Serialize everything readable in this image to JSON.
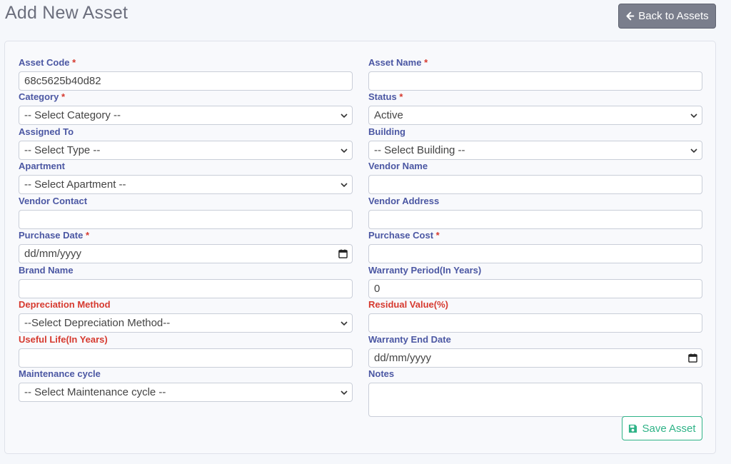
{
  "page": {
    "title": "Add New Asset"
  },
  "header": {
    "back_label": "Back to Assets"
  },
  "form": {
    "asset_code": {
      "label": "Asset Code",
      "required": "*",
      "value": "68c5625b40d82"
    },
    "asset_name": {
      "label": "Asset Name",
      "required": "*",
      "value": ""
    },
    "category": {
      "label": "Category",
      "required": "*",
      "selected": "-- Select Category --"
    },
    "status": {
      "label": "Status",
      "required": "*",
      "selected": "Active"
    },
    "assigned_to": {
      "label": "Assigned To",
      "selected": "-- Select Type --"
    },
    "building": {
      "label": "Building",
      "selected": "-- Select Building --"
    },
    "apartment": {
      "label": "Apartment",
      "selected": "-- Select Apartment --"
    },
    "vendor_name": {
      "label": "Vendor Name",
      "value": ""
    },
    "vendor_contact": {
      "label": "Vendor Contact",
      "value": ""
    },
    "vendor_address": {
      "label": "Vendor Address",
      "value": ""
    },
    "purchase_date": {
      "label": "Purchase Date",
      "required": "*",
      "value": "dd/mm/yyyy"
    },
    "purchase_cost": {
      "label": "Purchase Cost",
      "required": "*",
      "value": ""
    },
    "brand_name": {
      "label": "Brand Name",
      "value": ""
    },
    "warranty_period": {
      "label": "Warranty Period(In Years)",
      "value": "0"
    },
    "depreciation_method": {
      "label": "Depreciation Method",
      "selected": "--Select Depreciation Method--"
    },
    "residual_value": {
      "label": "Residual Value(%)",
      "value": ""
    },
    "useful_life": {
      "label": "Useful Life(In Years)",
      "value": ""
    },
    "warranty_end_date": {
      "label": "Warranty End Date",
      "value": "dd/mm/yyyy"
    },
    "maintenance_cycle": {
      "label": "Maintenance cycle",
      "selected": "-- Select Maintenance cycle --"
    },
    "notes": {
      "label": "Notes",
      "value": ""
    },
    "save_label": "Save Asset"
  },
  "colors": {
    "label": "#4b57a3",
    "label_alert": "#d63a2f",
    "back_button": "#7a7e8c",
    "save_button": "#2fb387"
  }
}
